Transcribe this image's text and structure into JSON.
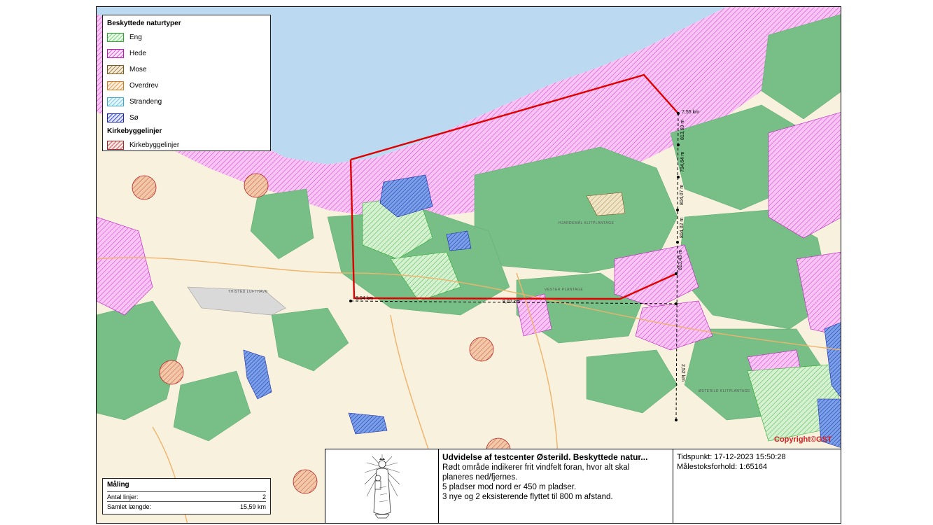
{
  "legend": {
    "header_naturtyper": "Beskyttede naturtyper",
    "items": [
      {
        "label": "Eng"
      },
      {
        "label": "Hede"
      },
      {
        "label": "Mose"
      },
      {
        "label": "Overdrev"
      },
      {
        "label": "Strandeng"
      },
      {
        "label": "Sø"
      }
    ],
    "header_kirke": "Kirkebyggelinjer",
    "kirke_item": "Kirkebyggelinjer"
  },
  "measurement": {
    "title": "Måling",
    "rows": [
      {
        "label": "Antal linjer:",
        "value": "2"
      },
      {
        "label": "Samlet længde:",
        "value": "15,59 km"
      }
    ]
  },
  "title_block": {
    "title": "Udvidelse af testcenter Østerild. Beskyttede natur...",
    "lines": [
      "Rødt område indikerer frit vindfelt foran, hvor alt skal",
      "planeres ned/fjernes.",
      "5 pladser mod nord er 450 m pladser.",
      "3 nye og 2 eksisterende flyttet til 800 m afstand."
    ],
    "timestamp": "Tidspunkt: 17-12-2023 15:50:28",
    "scale": "Målestoksforhold: 1:65164"
  },
  "copyright": "Copyright©GST",
  "map_labels": {
    "dist_top": "7,55 km",
    "dist_left": "8,04 km",
    "dist_bottom": "8,02 km",
    "seg1": "813,69 m",
    "seg2": "794,64 m",
    "seg3": "804,07 m",
    "seg4": "804,02 m",
    "seg5": "813,43 m",
    "seg6": "2,52 km",
    "lupthavn": "THISTED LUFTHAVN",
    "hjardemaal": "HJARDEMÅL KLITPLANTAGE",
    "hanstholm_plant": "ØSTERILD KLITPLANTAGE",
    "vester_plant": "VESTER PLANTAGE"
  },
  "colors": {
    "sea": "#bcd9f2",
    "farmland": "#f7f1dd",
    "forest": "#77bf86",
    "heath": "#f2b6ef",
    "boundary": "#e00000"
  }
}
